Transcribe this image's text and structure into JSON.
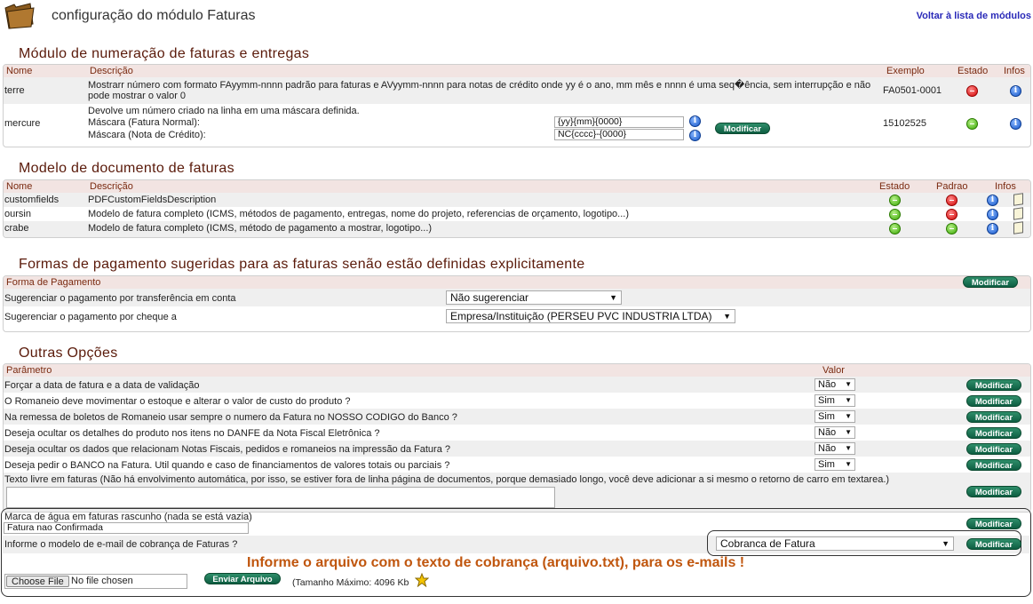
{
  "header": {
    "title": "configuração do módulo Faturas",
    "back_link": "Voltar à lista de módulos"
  },
  "numbering": {
    "title": "Módulo de numeração de faturas e entregas",
    "cols": {
      "name": "Nome",
      "desc": "Descrição",
      "example": "Exemplo",
      "status": "Estado",
      "info": "Infos"
    },
    "rows": [
      {
        "name": "terre",
        "desc": "Mostrarr número com formato FAyymm-nnnn padrão para faturas e AVyymm-nnnn para notas de crédito onde yy é o ano, mm mês e nnnn é uma seq�ência, sem interrupção e não pode mostrar o valor 0",
        "example": "FA0501-0001"
      },
      {
        "name": "mercure",
        "desc": "Devolve um número criado na linha em uma máscara definida.",
        "mask_invoice_label": "Máscara (Fatura Normal):",
        "mask_invoice_value": "{yy}{mm}{0000}",
        "mask_credit_label": "Máscara (Nota de Crédito):",
        "mask_credit_value": "NC{cccc}-{0000}",
        "modify": "Modificar",
        "example": "15102525"
      }
    ]
  },
  "docmodels": {
    "title": "Modelo de documento de faturas",
    "cols": {
      "name": "Nome",
      "desc": "Descrição",
      "status": "Estado",
      "default": "Padrao",
      "info": "Infos"
    },
    "rows": [
      {
        "name": "customfields",
        "desc": "PDFCustomFieldsDescription"
      },
      {
        "name": "oursin",
        "desc": "Modelo de fatura completo (ICMS, métodos de pagamento, entregas, nome do projeto, referencias de orçamento, logotipo...)"
      },
      {
        "name": "crabe",
        "desc": "Modelo de fatura completo (ICMS, método de pagamento a mostrar, logotipo...)"
      }
    ]
  },
  "payments": {
    "title": "Formas de pagamento sugeridas para as faturas senão estão definidas explicitamente",
    "col": "Forma de Pagamento",
    "modify": "Modificar",
    "rows": [
      {
        "label": "Sugerenciar o pagamento por transferência em conta",
        "value": "Não sugerenciar"
      },
      {
        "label": "Sugerenciar o pagamento por cheque a",
        "value": "Empresa/Instituição (PERSEU PVC INDUSTRIA LTDA)"
      }
    ]
  },
  "others": {
    "title": "Outras Opções",
    "cols": {
      "param": "Parâmetro",
      "value": "Valor"
    },
    "modify": "Modificar",
    "rows": [
      {
        "label": "Forçar a data de fatura e a data de validação",
        "value": "Não"
      },
      {
        "label": "O Romaneio deve movimentar o estoque e alterar o valor de custo do produto ?",
        "value": "Sim"
      },
      {
        "label": "Na remessa de boletos de Romaneio usar sempre o numero da Fatura no NOSSO CODIGO do Banco ?",
        "value": "Sim"
      },
      {
        "label": "Deseja ocultar os detalhes do produto nos itens no DANFE da Nota Fiscal Eletrônica ?",
        "value": "Não"
      },
      {
        "label": "Deseja ocultar os dados que relacionam Notas Fiscais, pedidos e romaneios na impressão da Fatura ?",
        "value": "Não"
      },
      {
        "label": "Deseja pedir o BANCO na Fatura. Util quando e caso de financiamentos de valores totais ou parciais ?",
        "value": "Sim"
      }
    ],
    "freetext_label": "Texto livre em faturas (Não há envolvimento automática, por isso, se estiver fora de linha página de documentos, porque demasiado longo, você deve adicionar a si mesmo o retorno de carro em textarea.)",
    "watermark_label": "Marca de água em faturas rascunho (nada se está vazia)",
    "watermark_value": "Fatura nao Confirmada",
    "email_label": "Informe o modelo de e-mail de cobrança de Faturas ?",
    "email_value": "Cobranca de Fatura",
    "file_heading": "Informe o arquivo com o texto de cobrança (arquivo.txt), para os e-mails !",
    "choose_file": "Choose File",
    "no_file": "No file chosen",
    "send": "Enviar Arquivo",
    "max_size": "(Tamanho Máximo: 4096 Kb"
  }
}
